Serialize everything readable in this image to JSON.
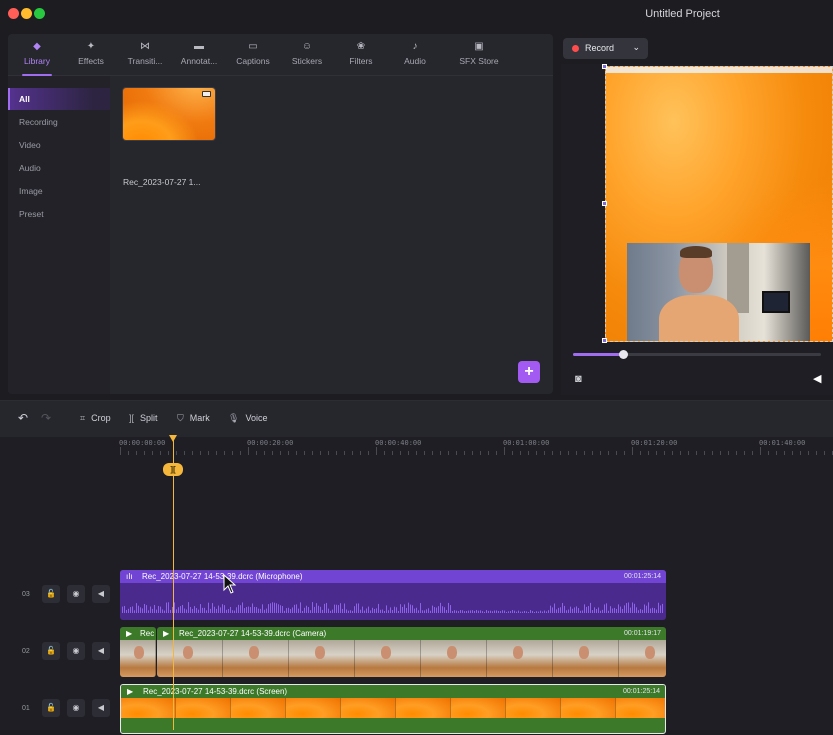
{
  "window": {
    "title": "Untitled Project",
    "traffic_colors": [
      "#ff5f57",
      "#febc2e",
      "#28c840"
    ]
  },
  "tabs": [
    {
      "label": "Library",
      "icon": "library-icon",
      "glyph": "◆",
      "active": true
    },
    {
      "label": "Effects",
      "icon": "effects-icon",
      "glyph": "✦"
    },
    {
      "label": "Transiti...",
      "icon": "transitions-icon",
      "glyph": "⋈"
    },
    {
      "label": "Annotat...",
      "icon": "annotations-icon",
      "glyph": "▬"
    },
    {
      "label": "Captions",
      "icon": "captions-icon",
      "glyph": "▭"
    },
    {
      "label": "Stickers",
      "icon": "stickers-icon",
      "glyph": "☺"
    },
    {
      "label": "Filters",
      "icon": "filters-icon",
      "glyph": "❀"
    },
    {
      "label": "Audio",
      "icon": "audio-icon",
      "glyph": "♪"
    },
    {
      "label": "SFX Store",
      "icon": "sfx-store-icon",
      "glyph": "▣"
    }
  ],
  "library": {
    "categories": [
      "All",
      "Recording",
      "Video",
      "Audio",
      "Image",
      "Preset"
    ],
    "active_category": "All",
    "media": [
      {
        "name": "Rec_2023-07-27 1..."
      }
    ],
    "add_label": "+"
  },
  "preview": {
    "record_label": "Record",
    "progress_fraction": 0.2,
    "accent": "#a06df0"
  },
  "toolbar": {
    "undo_glyph": "↶",
    "redo_glyph": "↷",
    "crop_label": "Crop",
    "split_label": "Split",
    "mark_label": "Mark",
    "voice_label": "Voice"
  },
  "ruler": {
    "labels": [
      "00:00:00:00",
      "00:00:20:00",
      "00:00:40:00",
      "00:01:00:00",
      "00:01:20:00",
      "00:01:40:00"
    ]
  },
  "playhead": {
    "color": "#f5b73b",
    "split_glyph": "]["
  },
  "tracks": [
    {
      "number": "03",
      "clips": [
        {
          "type": "audio",
          "name": "Rec_2023-07-27 14-53-39.dcrc (Microphone)",
          "duration": "00:01:25:14",
          "color": "#6a3ad0"
        }
      ]
    },
    {
      "number": "02",
      "clips": [
        {
          "type": "camera",
          "name": "Rec",
          "duration": "",
          "color": "#3e7a2c"
        },
        {
          "type": "camera",
          "name": "Rec_2023-07-27 14-53-39.dcrc (Camera)",
          "duration": "00:01:19:17",
          "color": "#3e7a2c"
        }
      ]
    },
    {
      "number": "01",
      "clips": [
        {
          "type": "screen",
          "name": "Rec_2023-07-27 14-53-39.dcrc (Screen)",
          "duration": "00:01:25:14",
          "color": "#3e7a2c"
        }
      ]
    }
  ]
}
